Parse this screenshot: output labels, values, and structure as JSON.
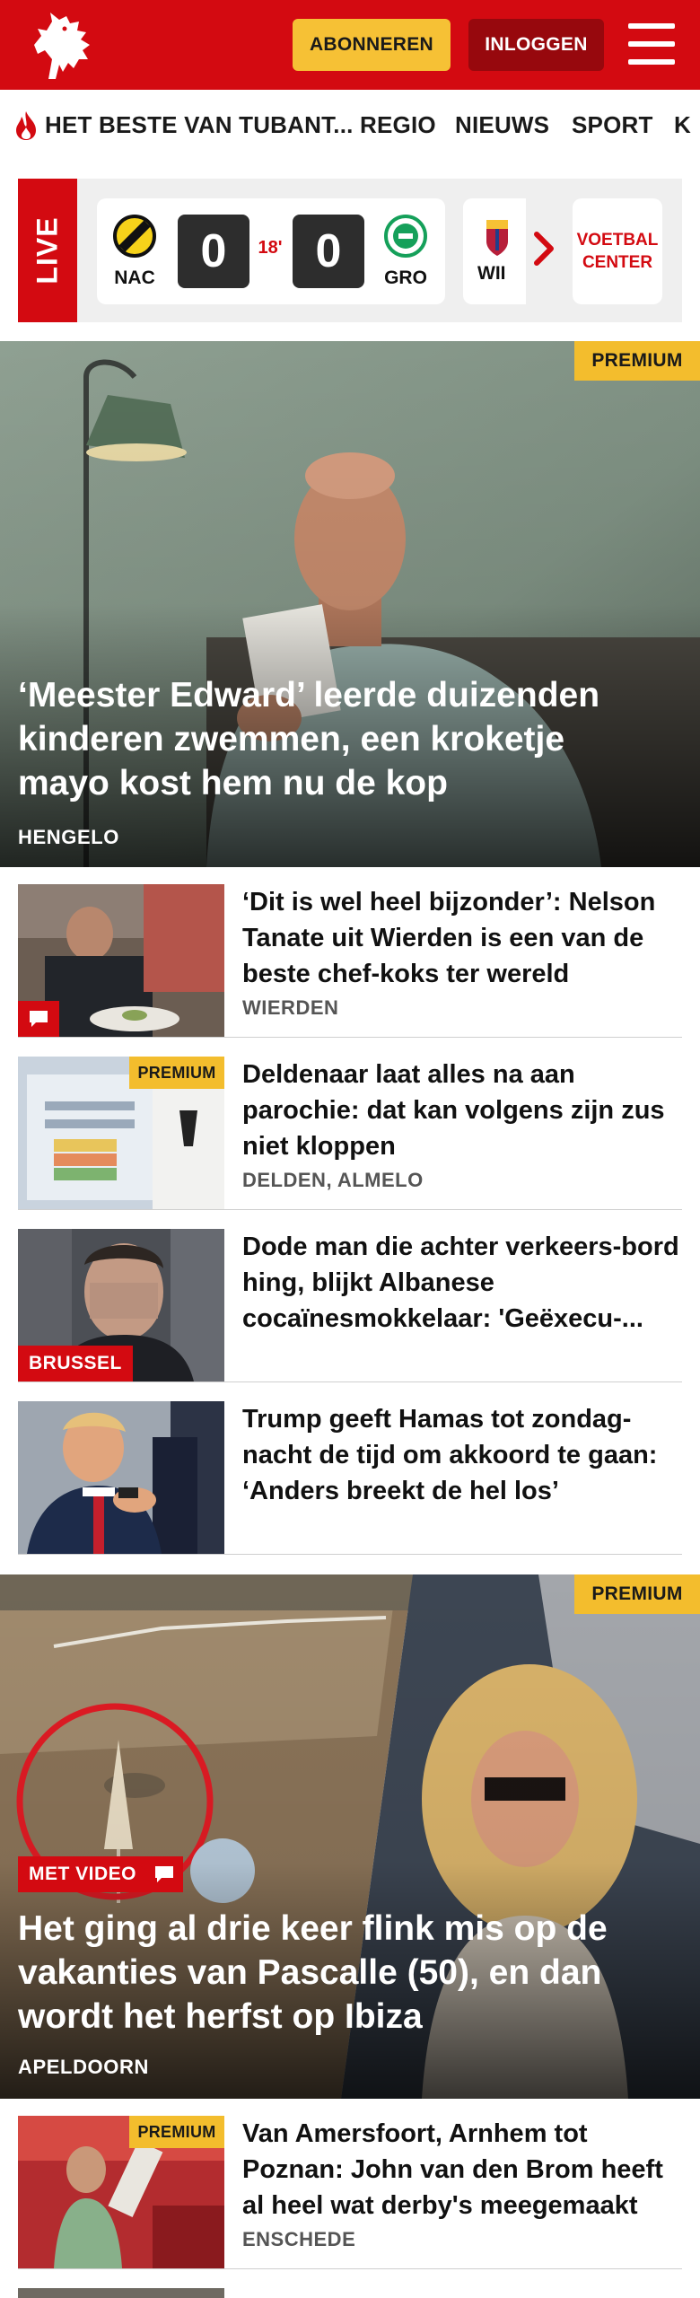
{
  "header": {
    "subscribe_label": "ABONNEREN",
    "login_label": "INLOGGEN",
    "brand_color": "#d30a11"
  },
  "nav": {
    "items": [
      "HET BESTE VAN TUBANT...",
      "REGIO",
      "NIEUWS",
      "SPORT",
      "K"
    ]
  },
  "live": {
    "label": "LIVE",
    "match": {
      "home": "NAC",
      "away": "GRO",
      "home_score": "0",
      "away_score": "0",
      "minute": "18'"
    },
    "next_team": "WII",
    "voetbal_center": [
      "VOETBAL",
      "CENTER"
    ]
  },
  "hero": {
    "badge": "PREMIUM",
    "title": "‘Meester Edward’ leerde duizenden kinderen zwemmen, een kroketje mayo kost hem nu de kop",
    "location": "HENGELO"
  },
  "articles": [
    {
      "title": "‘Dit is wel heel bijzonder’: Nelson Tanate uit Wierden is een van de beste chef-koks ter wereld",
      "location": "WIERDEN"
    },
    {
      "badge": "PREMIUM",
      "title": "Deldenaar laat alles na aan parochie: dat kan volgens zijn zus niet kloppen",
      "location": "DELDEN, ALMELO"
    },
    {
      "tag": "BRUSSEL",
      "title": "Dode man die achter verkeers-bord hing, blijkt Albanese cocaïnesmokkelaar: 'Geëxecu-...",
      "location": ""
    },
    {
      "title": "Trump geeft Hamas tot zondag-nacht de tijd om akkoord te gaan: ‘Anders breekt de hel los’",
      "location": ""
    }
  ],
  "hero2": {
    "badge": "PREMIUM",
    "video_tag": "MET VIDEO",
    "title": "Het ging al drie keer flink mis op de vakanties van Pascalle (50), en dan wordt het herfst op Ibiza",
    "location": "APELDOORN"
  },
  "articles2": [
    {
      "badge": "PREMIUM",
      "title": "Van Amersfoort, Arnhem tot Poznan: John van den Brom heeft al heel wat derby's meegemaakt",
      "location": "ENSCHEDE"
    }
  ]
}
